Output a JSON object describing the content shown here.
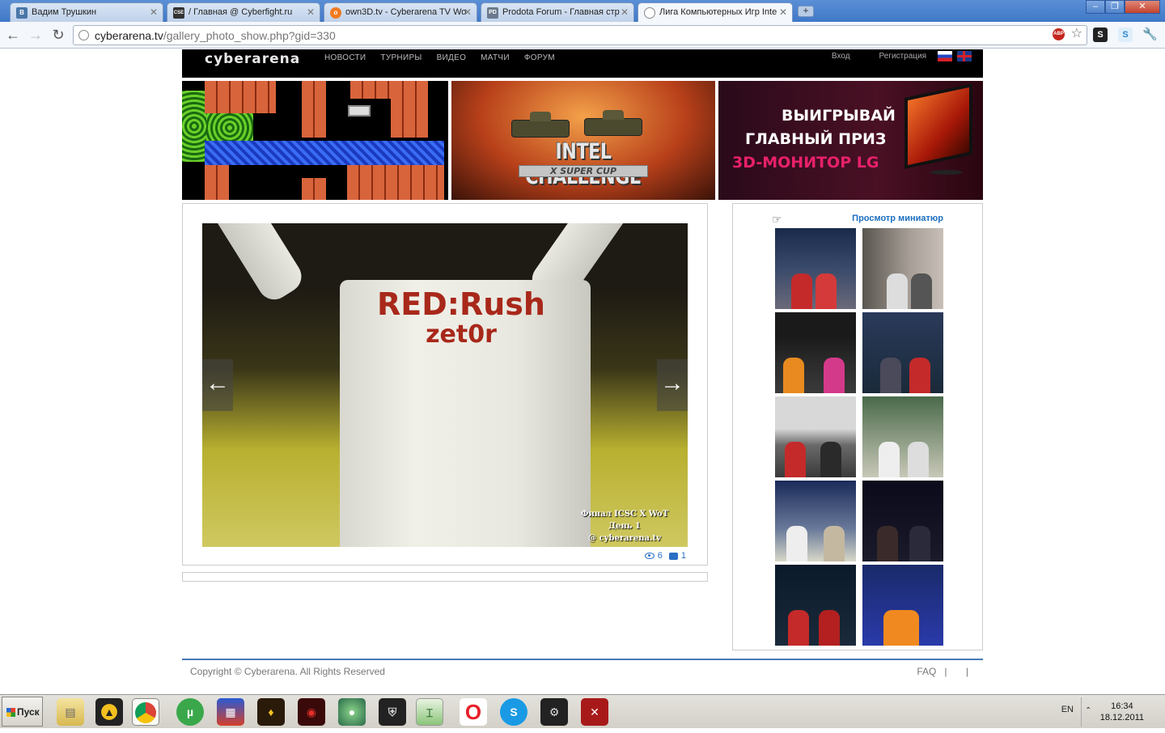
{
  "browser": {
    "tabs": [
      {
        "title": "Вадим Трушкин",
        "favicon": "VK",
        "favicon_color": "#4a76a8"
      },
      {
        "title": "/ Главная @ Cyberfight.ru",
        "favicon": "CSE",
        "favicon_color": "#333"
      },
      {
        "title": "own3D.tv - Cyberarena TV Wo",
        "favicon": "o",
        "favicon_color": "#f07a20"
      },
      {
        "title": "Prodota Forum - Главная стр",
        "favicon": "PD",
        "favicon_color": "#6a7a8c"
      },
      {
        "title": "Лига Компьютерных Игр Inte",
        "favicon": "globe",
        "favicon_color": "#888"
      }
    ],
    "url_domain": "cyberarena.tv",
    "url_path": "/gallery_photo_show.php?gid=330",
    "abp_label": "ABP"
  },
  "site": {
    "logo": "cyberarena",
    "nav": [
      "НОВОСТИ",
      "ТУРНИРЫ",
      "ВИДЕО",
      "МАТЧИ",
      "ФОРУМ"
    ],
    "login": "Вход",
    "register": "Регистрация",
    "banner_intel": {
      "title": "INTEL CHALLENGE",
      "subtitle": "X SUPER CUP"
    },
    "banner_lg": {
      "line1": "ВЫИГРЫВАЙ",
      "line2": "ГЛАВНЫЙ ПРИЗ",
      "line3": "3D-МОНИТОР LG"
    },
    "photo": {
      "shirt_line1": "RED:Rush",
      "shirt_line2": "zet0r",
      "caption_line1": "Финал ICSC X WoT",
      "caption_line2": "День 1",
      "caption_line3": "@ cyberarena.tv",
      "prev_arrow": "←",
      "next_arrow": "→",
      "views": "6",
      "comments": "1"
    },
    "thumbs_label": "Просмотр миниатюр",
    "footer_copy": "Copyright © Cyberarena. All Rights Reserved",
    "footer_faq": "FAQ",
    "footer_sep": "|"
  },
  "taskbar": {
    "start_label": "Пуск",
    "lang": "EN",
    "time": "16:34",
    "date": "18.12.2011"
  }
}
